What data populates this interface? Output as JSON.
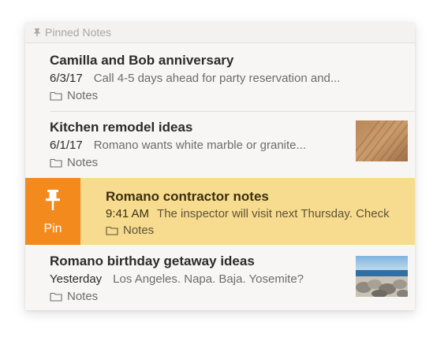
{
  "pinned_section": {
    "label": "Pinned Notes",
    "icon": "pin-icon"
  },
  "notes": [
    {
      "title": "Camilla and Bob anniversary",
      "date": "6/3/17",
      "snippet": "Call 4-5 days ahead for party reservation and...",
      "folder": "Notes"
    },
    {
      "title": "Kitchen remodel ideas",
      "date": "6/1/17",
      "snippet": "Romano wants white marble or granite...",
      "folder": "Notes",
      "thumbnail": "wood-floor-photo"
    },
    {
      "title": "Romano contractor notes",
      "date": "9:41 AM",
      "snippet": "The inspector will visit next Thursday. Check",
      "folder": "Notes"
    },
    {
      "title": "Romano birthday getaway ideas",
      "date": "Yesterday",
      "snippet": "Los Angeles. Napa. Baja. Yosemite?",
      "folder": "Notes",
      "thumbnail": "beach-rocks-photo"
    }
  ],
  "swipe_action": {
    "label": "Pin",
    "icon": "pin-icon"
  },
  "colors": {
    "pin_action_bg": "#f28a1e",
    "highlight_row_bg": "#f7dc8f",
    "list_bg": "#f7f6f4"
  }
}
